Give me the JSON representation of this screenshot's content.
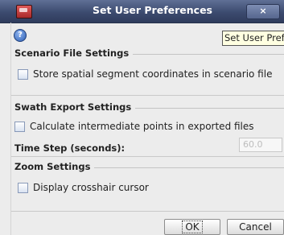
{
  "window": {
    "title": "Set User Preferences",
    "close_label": "×",
    "help_icon": "question-circle-icon",
    "tooltip": "Set User Preferences"
  },
  "sections": {
    "scenario": {
      "title": "Scenario File Settings",
      "store_coords_label": "Store spatial segment coordinates in scenario file",
      "store_coords_checked": false
    },
    "swath": {
      "title": "Swath Export Settings",
      "intermediate_label": "Calculate intermediate points in exported files",
      "intermediate_checked": false,
      "time_step_label": "Time Step (seconds):",
      "time_step_value": "60.0"
    },
    "zoom": {
      "title": "Zoom Settings",
      "crosshair_label": "Display crosshair cursor",
      "crosshair_checked": false
    }
  },
  "buttons": {
    "ok": "OK",
    "cancel": "Cancel"
  },
  "colors": {
    "titlebar": "#3c4b6f",
    "background": "#ececec",
    "tooltip": "#ffffe1"
  }
}
